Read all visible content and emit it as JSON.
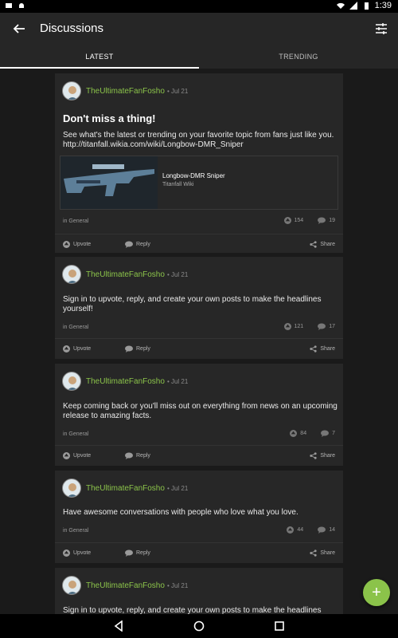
{
  "status_bar": {
    "time": "1:39"
  },
  "app_bar": {
    "title": "Discussions"
  },
  "tabs": [
    {
      "label": "LATEST",
      "active": true
    },
    {
      "label": "TRENDING",
      "active": false
    }
  ],
  "posts": [
    {
      "author": "TheUltimateFanFosho",
      "date": "• Jul 21",
      "title": "Don't miss a thing!",
      "body": "See what's the latest or trending on your favorite topic from fans just like you. http://titanfall.wikia.com/wiki/Longbow-DMR_Sniper",
      "link_title": "Longbow-DMR Sniper",
      "link_source": "Titanfall Wiki",
      "category": "in General",
      "upvotes": "154",
      "replies": "19"
    },
    {
      "author": "TheUltimateFanFosho",
      "date": "• Jul 21",
      "body": "Sign in to upvote, reply, and create your own posts to make the headlines yourself!",
      "category": "in General",
      "upvotes": "121",
      "replies": "17"
    },
    {
      "author": "TheUltimateFanFosho",
      "date": "• Jul 21",
      "body": "Keep coming back or you'll miss out on everything from news on an upcoming release to amazing facts.",
      "category": "in General",
      "upvotes": "84",
      "replies": "7"
    },
    {
      "author": "TheUltimateFanFosho",
      "date": "• Jul 21",
      "body": "Have awesome conversations with people who love what you love.",
      "category": "in General",
      "upvotes": "44",
      "replies": "14"
    },
    {
      "author": "TheUltimateFanFosho",
      "date": "• Jul 21",
      "body": "Sign in to upvote, reply, and create your own posts to make the headlines"
    }
  ],
  "actions": {
    "upvote": "Upvote",
    "reply": "Reply",
    "share": "Share"
  },
  "fab": {
    "icon": "plus-icon",
    "label": "+"
  },
  "colors": {
    "accent": "#8bc34a",
    "card": "#272727",
    "background": "#1a1a1a"
  }
}
